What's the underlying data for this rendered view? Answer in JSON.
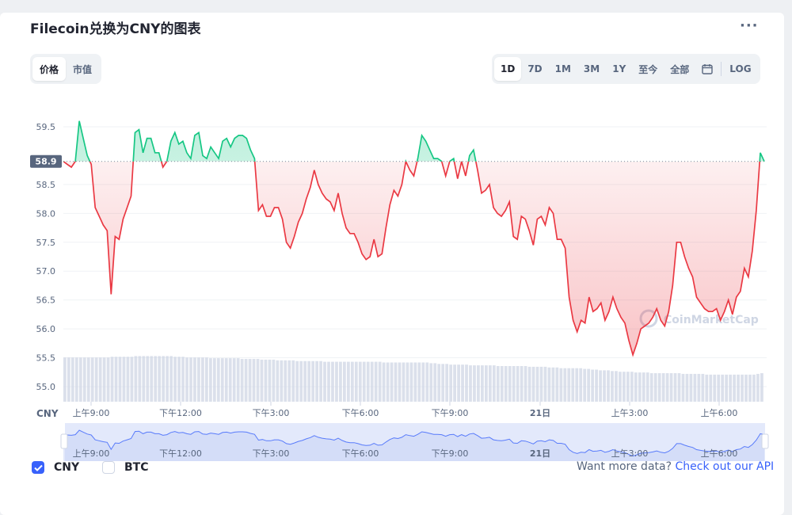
{
  "title": "Filecoin兑换为CNY的图表",
  "more_icon": "ellipsis-icon",
  "view_tabs": [
    {
      "label": "价格",
      "active": true
    },
    {
      "label": "市值",
      "active": false
    }
  ],
  "range_tabs": [
    {
      "label": "1D",
      "active": true
    },
    {
      "label": "7D",
      "active": false
    },
    {
      "label": "1M",
      "active": false
    },
    {
      "label": "3M",
      "active": false
    },
    {
      "label": "1Y",
      "active": false
    },
    {
      "label": "至今",
      "active": false
    },
    {
      "label": "全部",
      "active": false
    }
  ],
  "calendar_icon": "calendar-icon",
  "log_label": "LOG",
  "legend": [
    {
      "label": "CNY",
      "checked": true
    },
    {
      "label": "BTC",
      "checked": false
    }
  ],
  "api_prefix": "Want more data?",
  "api_link": "Check out our API",
  "watermark": "CoinMarketCap",
  "colors": {
    "up": "#16c784",
    "down": "#ea3943",
    "accent": "#3861fb"
  },
  "chart_data": {
    "type": "line",
    "currency_label": "CNY",
    "reference_price": 58.9,
    "ylim": [
      54.8,
      59.8
    ],
    "yticks": [
      59.5,
      58.9,
      58.5,
      58.0,
      57.5,
      57.0,
      56.5,
      56.0,
      55.5,
      55.0
    ],
    "xticks": [
      "上午9:00",
      "下午12:00",
      "下午3:00",
      "下午6:00",
      "下午9:00",
      "21日",
      "上午3:00",
      "上午6:00"
    ],
    "grid": true,
    "series": [
      {
        "values": [
          58.9,
          58.85,
          58.8,
          58.9,
          59.6,
          59.3,
          59.0,
          58.85,
          58.1,
          57.95,
          57.8,
          57.7,
          56.6,
          57.6,
          57.55,
          57.9,
          58.1,
          58.3,
          59.4,
          59.45,
          59.05,
          59.3,
          59.3,
          59.05,
          59.05,
          58.8,
          58.9,
          59.25,
          59.4,
          59.2,
          59.25,
          59.05,
          58.95,
          59.35,
          59.4,
          59.0,
          58.95,
          59.15,
          59.05,
          58.95,
          59.25,
          59.3,
          59.15,
          59.3,
          59.35,
          59.35,
          59.3,
          59.1,
          58.95,
          58.05,
          58.15,
          57.95,
          57.95,
          58.1,
          58.1,
          57.9,
          57.5,
          57.4,
          57.6,
          57.85,
          58.0,
          58.25,
          58.45,
          58.75,
          58.5,
          58.35,
          58.25,
          58.2,
          58.05,
          58.35,
          58.0,
          57.75,
          57.65,
          57.65,
          57.5,
          57.3,
          57.2,
          57.25,
          57.55,
          57.25,
          57.3,
          57.75,
          58.15,
          58.4,
          58.3,
          58.5,
          58.9,
          58.75,
          58.65,
          58.95,
          59.35,
          59.25,
          59.1,
          58.95,
          58.95,
          58.9,
          58.65,
          58.9,
          58.95,
          58.6,
          58.9,
          58.65,
          59.0,
          59.1,
          58.75,
          58.35,
          58.4,
          58.5,
          58.1,
          58.0,
          57.95,
          58.05,
          58.2,
          57.6,
          57.55,
          57.95,
          57.9,
          57.7,
          57.45,
          57.9,
          57.95,
          57.8,
          58.1,
          58.0,
          57.55,
          57.55,
          57.4,
          56.55,
          56.15,
          55.95,
          56.15,
          56.1,
          56.55,
          56.3,
          56.35,
          56.45,
          56.15,
          56.3,
          56.55,
          56.35,
          56.2,
          56.1,
          55.8,
          55.55,
          55.75,
          56.0,
          56.05,
          56.1,
          56.2,
          56.35,
          56.15,
          56.05,
          56.3,
          56.75,
          57.5,
          57.5,
          57.25,
          57.05,
          56.9,
          56.55,
          56.45,
          56.35,
          56.3,
          56.3,
          56.35,
          56.15,
          56.3,
          56.5,
          56.25,
          56.55,
          56.65,
          57.05,
          56.9,
          57.35,
          58.05,
          59.05,
          58.9
        ]
      }
    ],
    "volume": [
      0.62,
      0.62,
      0.62,
      0.62,
      0.62,
      0.62,
      0.62,
      0.62,
      0.62,
      0.62,
      0.62,
      0.62,
      0.63,
      0.63,
      0.63,
      0.63,
      0.63,
      0.63,
      0.64,
      0.64,
      0.64,
      0.64,
      0.64,
      0.64,
      0.64,
      0.64,
      0.64,
      0.64,
      0.63,
      0.63,
      0.63,
      0.62,
      0.62,
      0.62,
      0.62,
      0.62,
      0.62,
      0.61,
      0.61,
      0.61,
      0.61,
      0.61,
      0.61,
      0.61,
      0.61,
      0.6,
      0.6,
      0.6,
      0.6,
      0.6,
      0.59,
      0.59,
      0.59,
      0.59,
      0.58,
      0.58,
      0.58,
      0.58,
      0.58,
      0.57,
      0.57,
      0.57,
      0.57,
      0.57,
      0.57,
      0.57,
      0.56,
      0.56,
      0.56,
      0.56,
      0.56,
      0.56,
      0.56,
      0.56,
      0.56,
      0.56,
      0.56,
      0.56,
      0.56,
      0.56,
      0.56,
      0.55,
      0.55,
      0.55,
      0.55,
      0.55,
      0.55,
      0.55,
      0.55,
      0.55,
      0.55,
      0.55,
      0.55,
      0.54,
      0.54,
      0.53,
      0.53,
      0.53,
      0.52,
      0.52,
      0.52,
      0.52,
      0.52,
      0.51,
      0.51,
      0.51,
      0.51,
      0.51,
      0.51,
      0.51,
      0.5,
      0.5,
      0.5,
      0.5,
      0.5,
      0.5,
      0.5,
      0.5,
      0.49,
      0.49,
      0.49,
      0.49,
      0.49,
      0.48,
      0.48,
      0.48,
      0.47,
      0.47,
      0.47,
      0.47,
      0.47,
      0.47,
      0.46,
      0.46,
      0.45,
      0.45,
      0.44,
      0.44,
      0.44,
      0.43,
      0.43,
      0.42,
      0.42,
      0.42,
      0.42,
      0.41,
      0.41,
      0.41,
      0.41,
      0.4,
      0.4,
      0.4,
      0.4,
      0.4,
      0.4,
      0.4,
      0.4,
      0.39,
      0.39,
      0.39,
      0.39,
      0.39,
      0.39,
      0.38,
      0.38,
      0.38,
      0.38,
      0.38,
      0.38,
      0.38,
      0.38,
      0.38,
      0.38,
      0.38,
      0.38,
      0.38,
      0.39,
      0.4
    ]
  }
}
